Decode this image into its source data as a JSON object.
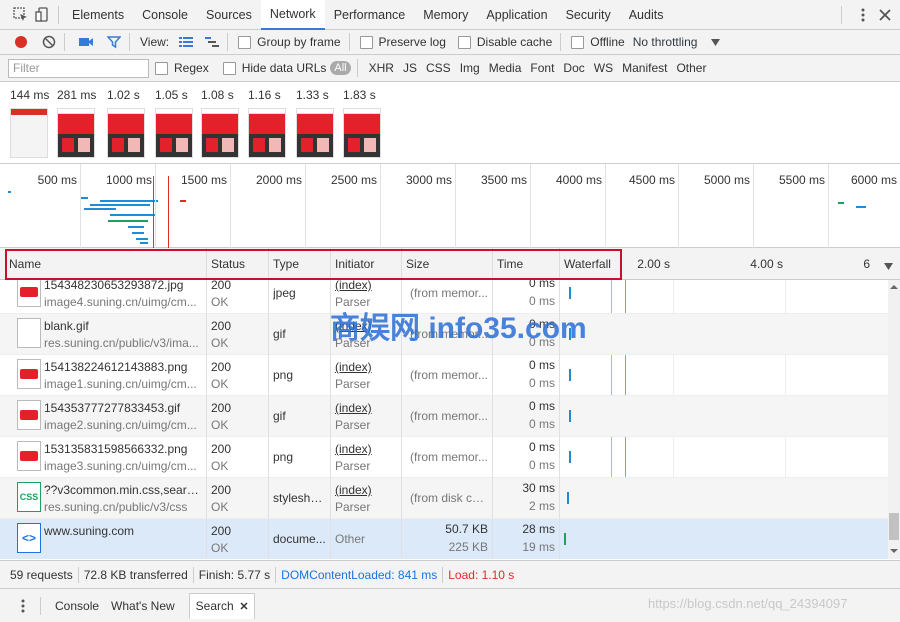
{
  "tabs": [
    "Elements",
    "Console",
    "Sources",
    "Network",
    "Performance",
    "Memory",
    "Application",
    "Security",
    "Audits"
  ],
  "active_tab": "Network",
  "toolbar": {
    "view_label": "View:",
    "group_by_frame": "Group by frame",
    "preserve_log": "Preserve log",
    "disable_cache": "Disable cache",
    "offline": "Offline",
    "throttling": "No throttling"
  },
  "filter": {
    "placeholder": "Filter",
    "regex": "Regex",
    "hide_data_urls": "Hide data URLs",
    "all": "All",
    "types": [
      "XHR",
      "JS",
      "CSS",
      "Img",
      "Media",
      "Font",
      "Doc",
      "WS",
      "Manifest",
      "Other"
    ]
  },
  "filmstrip": [
    "144 ms",
    "281 ms",
    "1.02 s",
    "1.05 s",
    "1.08 s",
    "1.16 s",
    "1.33 s",
    "1.83 s"
  ],
  "overview_ticks": [
    "500 ms",
    "1000 ms",
    "1500 ms",
    "2000 ms",
    "2500 ms",
    "3000 ms",
    "3500 ms",
    "4000 ms",
    "4500 ms",
    "5000 ms",
    "5500 ms",
    "6000 ms"
  ],
  "columns": {
    "name": "Name",
    "status": "Status",
    "type": "Type",
    "initiator": "Initiator",
    "size": "Size",
    "time": "Time",
    "waterfall": "Waterfall"
  },
  "waterfall_ticks": [
    "2.00 s",
    "4.00 s",
    "6"
  ],
  "requests": [
    {
      "name": "154348230653293872.jpg",
      "path": "image4.suning.cn/uimg/cm...",
      "status": "200",
      "status_text": "OK",
      "type": "jpeg",
      "initiator": "(index)",
      "initiator_sub": "Parser",
      "size": "(from memor...",
      "time": "0 ms",
      "latency": "0 ms",
      "icon": "image-file-icon"
    },
    {
      "name": "blank.gif",
      "path": "res.suning.cn/public/v3/ima...",
      "status": "200",
      "status_text": "OK",
      "type": "gif",
      "initiator": "(index)",
      "initiator_sub": "Parser",
      "size": "(from memor...",
      "time": "0 ms",
      "latency": "0 ms",
      "icon": "blank-file-icon"
    },
    {
      "name": "154138224612143883.png",
      "path": "image1.suning.cn/uimg/cm...",
      "status": "200",
      "status_text": "OK",
      "type": "png",
      "initiator": "(index)",
      "initiator_sub": "Parser",
      "size": "(from memor...",
      "time": "0 ms",
      "latency": "0 ms",
      "icon": "image-file-icon"
    },
    {
      "name": "154353777277833453.gif",
      "path": "image2.suning.cn/uimg/cm...",
      "status": "200",
      "status_text": "OK",
      "type": "gif",
      "initiator": "(index)",
      "initiator_sub": "Parser",
      "size": "(from memor...",
      "time": "0 ms",
      "latency": "0 ms",
      "icon": "image-file-icon"
    },
    {
      "name": "153135831598566332.png",
      "path": "image3.suning.cn/uimg/cm...",
      "status": "200",
      "status_text": "OK",
      "type": "png",
      "initiator": "(index)",
      "initiator_sub": "Parser",
      "size": "(from memor...",
      "time": "0 ms",
      "latency": "0 ms",
      "icon": "image-file-icon"
    },
    {
      "name": "??v3common.min.css,search...",
      "path": "res.suning.cn/public/v3/css",
      "status": "200",
      "status_text": "OK",
      "type": "stylesheet",
      "initiator": "(index)",
      "initiator_sub": "Parser",
      "size": "(from disk cac...",
      "time": "30 ms",
      "latency": "2 ms",
      "icon": "css-file-icon",
      "icon_text": "CSS"
    },
    {
      "name": "www.suning.com",
      "path": "",
      "status": "200",
      "status_text": "OK",
      "type": "docume...",
      "initiator": "Other",
      "initiator_sub": "",
      "size": "50.7 KB",
      "size_sub": "225 KB",
      "time": "28 ms",
      "latency": "19 ms",
      "icon": "document-file-icon",
      "icon_text": "<>"
    }
  ],
  "status": {
    "requests": "59 requests",
    "transferred": "72.8 KB transferred",
    "finish": "Finish: 5.77 s",
    "dom_content_loaded": "DOMContentLoaded: 841 ms",
    "load": "Load: 1.10 s"
  },
  "drawer_tabs": [
    "Console",
    "What's New",
    "Search"
  ],
  "watermark": "商娱网 info35.com",
  "csdn_watermark": "https://blog.csdn.net/qq_24394097",
  "colors": {
    "accent": "#3879d9",
    "record": "#d93025",
    "dcl": "#1a73e8",
    "load": "#d93025",
    "highlight_box": "#c8102e"
  }
}
